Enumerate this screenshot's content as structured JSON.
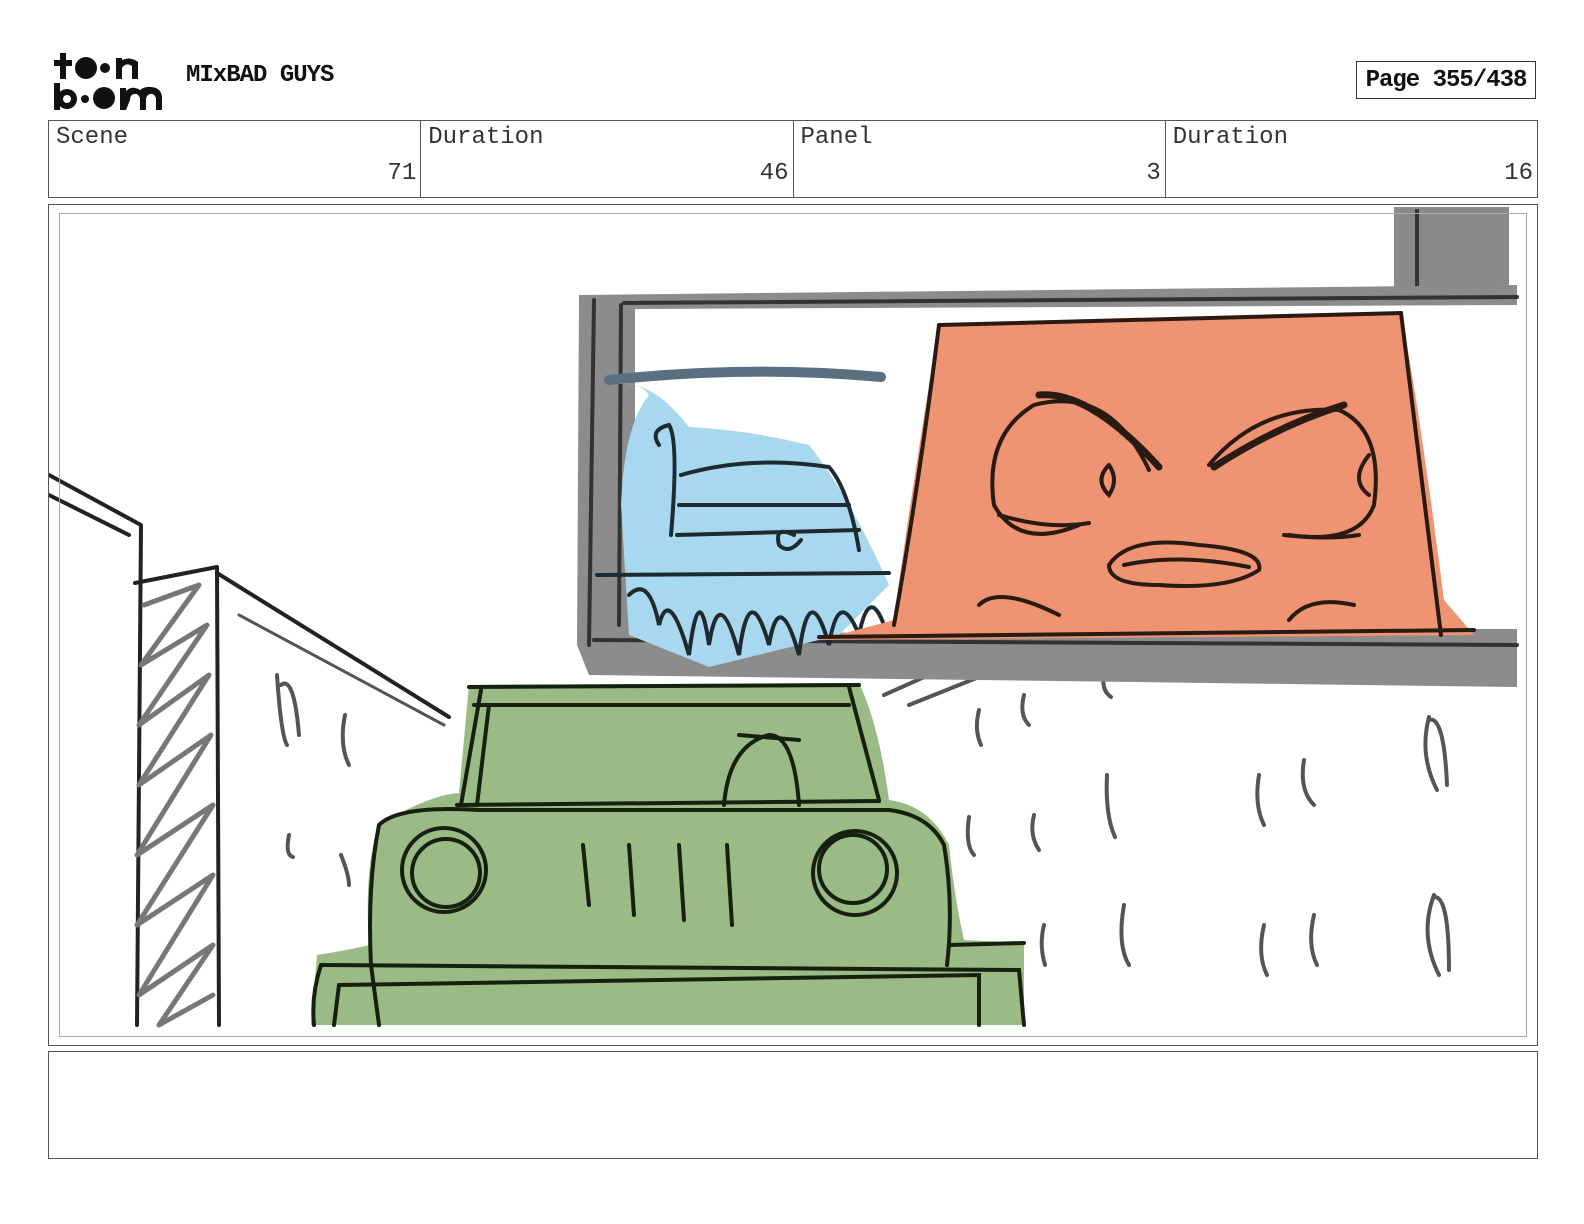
{
  "header": {
    "logo_text": "toon boom",
    "project_title": "MIxBAD GUYS",
    "page_label": "Page 355/438"
  },
  "info": {
    "scene_label": "Scene",
    "scene_value": "71",
    "scene_duration_label": "Duration",
    "scene_duration_value": "46",
    "panel_label": "Panel",
    "panel_value": "3",
    "panel_duration_label": "Duration",
    "panel_duration_value": "16"
  },
  "notes": {
    "text": ""
  }
}
